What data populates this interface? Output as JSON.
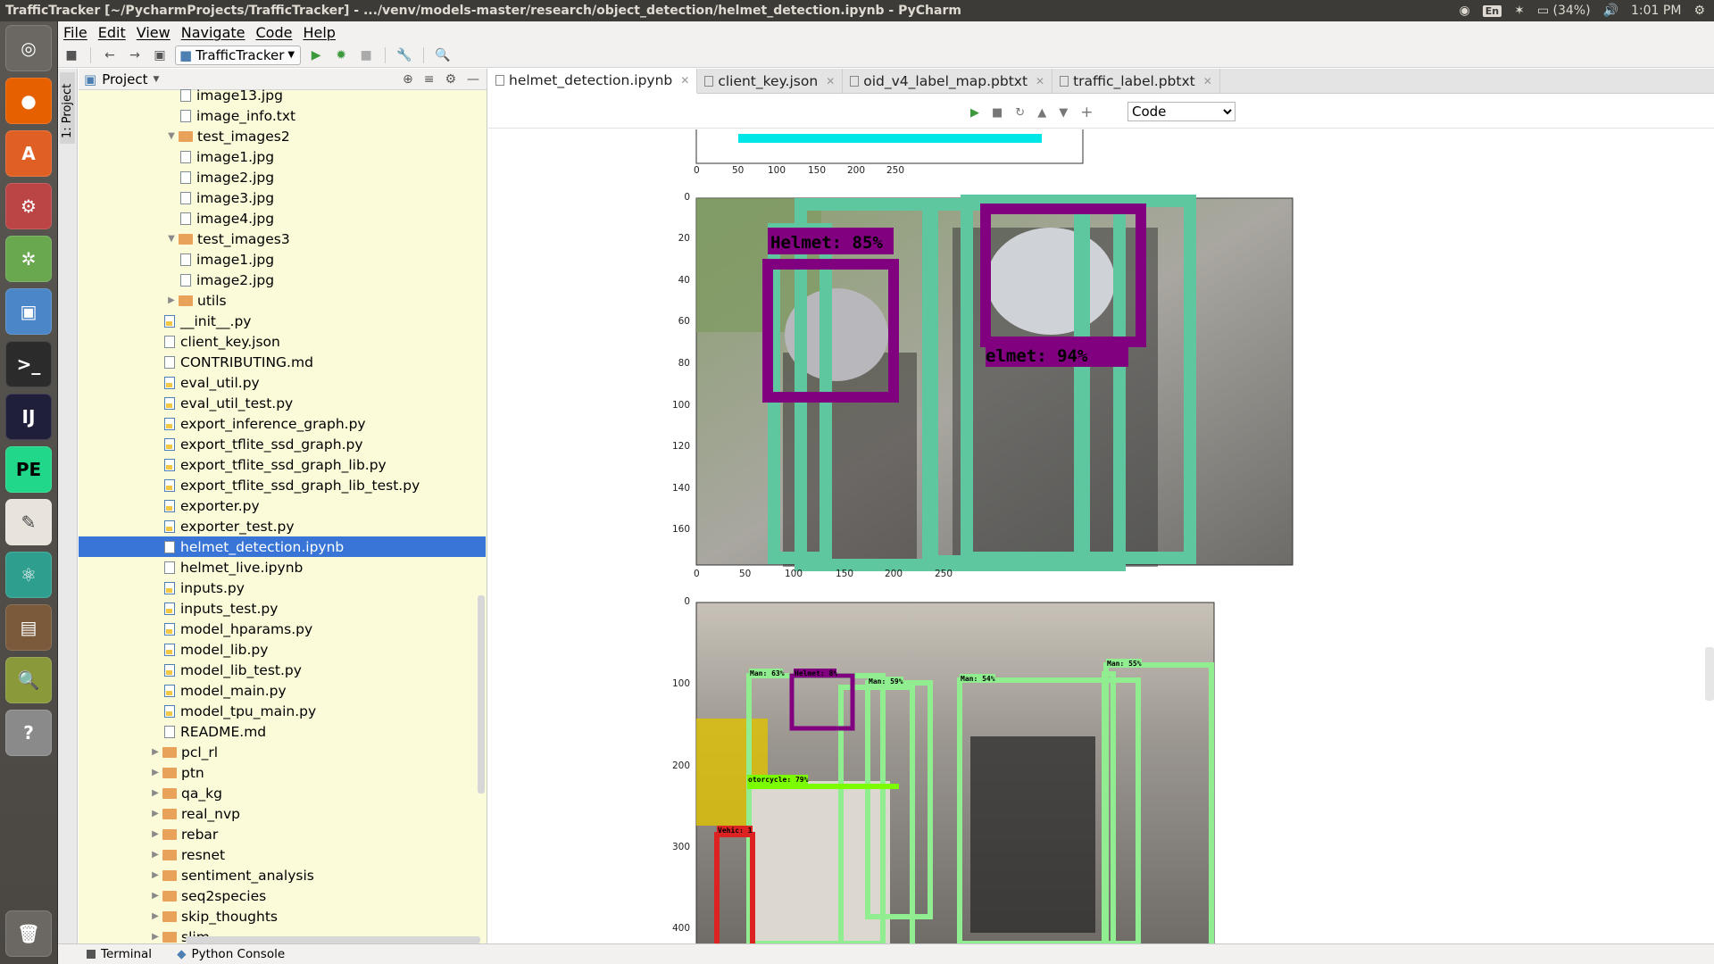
{
  "window_title": "TrafficTracker [~/PycharmProjects/TrafficTracker] - .../venv/models-master/research/object_detection/helmet_detection.ipynb - PyCharm",
  "tray": {
    "lang": "En",
    "battery": "(34%)",
    "time": "1:01 PM"
  },
  "menu": [
    "File",
    "Edit",
    "View",
    "Navigate",
    "Code",
    "Help"
  ],
  "toolbar": {
    "run_config": "TrafficTracker"
  },
  "stripe_label": "1: Project",
  "project": {
    "header": "Project",
    "items": [
      {
        "label": "image13.jpg",
        "kind": "file",
        "depth": 2
      },
      {
        "label": "image_info.txt",
        "kind": "file",
        "depth": 2
      },
      {
        "label": "test_images2",
        "kind": "dir-open",
        "depth": 1
      },
      {
        "label": "image1.jpg",
        "kind": "file",
        "depth": 2
      },
      {
        "label": "image2.jpg",
        "kind": "file",
        "depth": 2
      },
      {
        "label": "image3.jpg",
        "kind": "file",
        "depth": 2
      },
      {
        "label": "image4.jpg",
        "kind": "file",
        "depth": 2
      },
      {
        "label": "test_images3",
        "kind": "dir-open",
        "depth": 1
      },
      {
        "label": "image1.jpg",
        "kind": "file",
        "depth": 2
      },
      {
        "label": "image2.jpg",
        "kind": "file",
        "depth": 2
      },
      {
        "label": "utils",
        "kind": "dir",
        "depth": 1
      },
      {
        "label": "__init__.py",
        "kind": "py",
        "depth": 1
      },
      {
        "label": "client_key.json",
        "kind": "file",
        "depth": 1
      },
      {
        "label": "CONTRIBUTING.md",
        "kind": "file",
        "depth": 1
      },
      {
        "label": "eval_util.py",
        "kind": "py",
        "depth": 1
      },
      {
        "label": "eval_util_test.py",
        "kind": "py",
        "depth": 1
      },
      {
        "label": "export_inference_graph.py",
        "kind": "py",
        "depth": 1
      },
      {
        "label": "export_tflite_ssd_graph.py",
        "kind": "py",
        "depth": 1
      },
      {
        "label": "export_tflite_ssd_graph_lib.py",
        "kind": "py",
        "depth": 1
      },
      {
        "label": "export_tflite_ssd_graph_lib_test.py",
        "kind": "py",
        "depth": 1
      },
      {
        "label": "exporter.py",
        "kind": "py",
        "depth": 1
      },
      {
        "label": "exporter_test.py",
        "kind": "py",
        "depth": 1
      },
      {
        "label": "helmet_detection.ipynb",
        "kind": "file",
        "depth": 1,
        "selected": true
      },
      {
        "label": "helmet_live.ipynb",
        "kind": "file",
        "depth": 1
      },
      {
        "label": "inputs.py",
        "kind": "py",
        "depth": 1
      },
      {
        "label": "inputs_test.py",
        "kind": "py",
        "depth": 1
      },
      {
        "label": "model_hparams.py",
        "kind": "py",
        "depth": 1
      },
      {
        "label": "model_lib.py",
        "kind": "py",
        "depth": 1
      },
      {
        "label": "model_lib_test.py",
        "kind": "py",
        "depth": 1
      },
      {
        "label": "model_main.py",
        "kind": "py",
        "depth": 1
      },
      {
        "label": "model_tpu_main.py",
        "kind": "py",
        "depth": 1
      },
      {
        "label": "README.md",
        "kind": "file",
        "depth": 1
      },
      {
        "label": "pcl_rl",
        "kind": "dir",
        "depth": 0
      },
      {
        "label": "ptn",
        "kind": "dir",
        "depth": 0
      },
      {
        "label": "qa_kg",
        "kind": "dir",
        "depth": 0
      },
      {
        "label": "real_nvp",
        "kind": "dir",
        "depth": 0
      },
      {
        "label": "rebar",
        "kind": "dir",
        "depth": 0
      },
      {
        "label": "resnet",
        "kind": "dir",
        "depth": 0
      },
      {
        "label": "sentiment_analysis",
        "kind": "dir",
        "depth": 0
      },
      {
        "label": "seq2species",
        "kind": "dir",
        "depth": 0
      },
      {
        "label": "skip_thoughts",
        "kind": "dir",
        "depth": 0
      },
      {
        "label": "slim",
        "kind": "dir",
        "depth": 0
      }
    ]
  },
  "tabs": [
    {
      "label": "helmet_detection.ipynb",
      "active": true
    },
    {
      "label": "client_key.json"
    },
    {
      "label": "oid_v4_label_map.pbtxt"
    },
    {
      "label": "traffic_label.pbtxt"
    }
  ],
  "cell_type": "Code",
  "plots": [
    {
      "xticks": [
        "0",
        "50",
        "100",
        "150",
        "200",
        "250"
      ],
      "yticks": []
    },
    {
      "xticks": [
        "0",
        "50",
        "100",
        "150",
        "200",
        "250"
      ],
      "yticks": [
        "0",
        "20",
        "40",
        "60",
        "80",
        "100",
        "120",
        "140",
        "160"
      ],
      "labels": [
        "Helmet: 85%",
        "elmet: 94%"
      ]
    },
    {
      "xticks": [],
      "yticks": [
        "0",
        "100",
        "200",
        "300",
        "400"
      ],
      "labels": [
        "Man: 63%",
        "Helmet: 8%",
        "Man: 59%",
        "Man: 54%",
        "Man: 55%",
        "otorcycle: 79%",
        "Vehic: 1"
      ]
    }
  ],
  "bottom": {
    "terminal": "Terminal",
    "console": "Python Console"
  }
}
